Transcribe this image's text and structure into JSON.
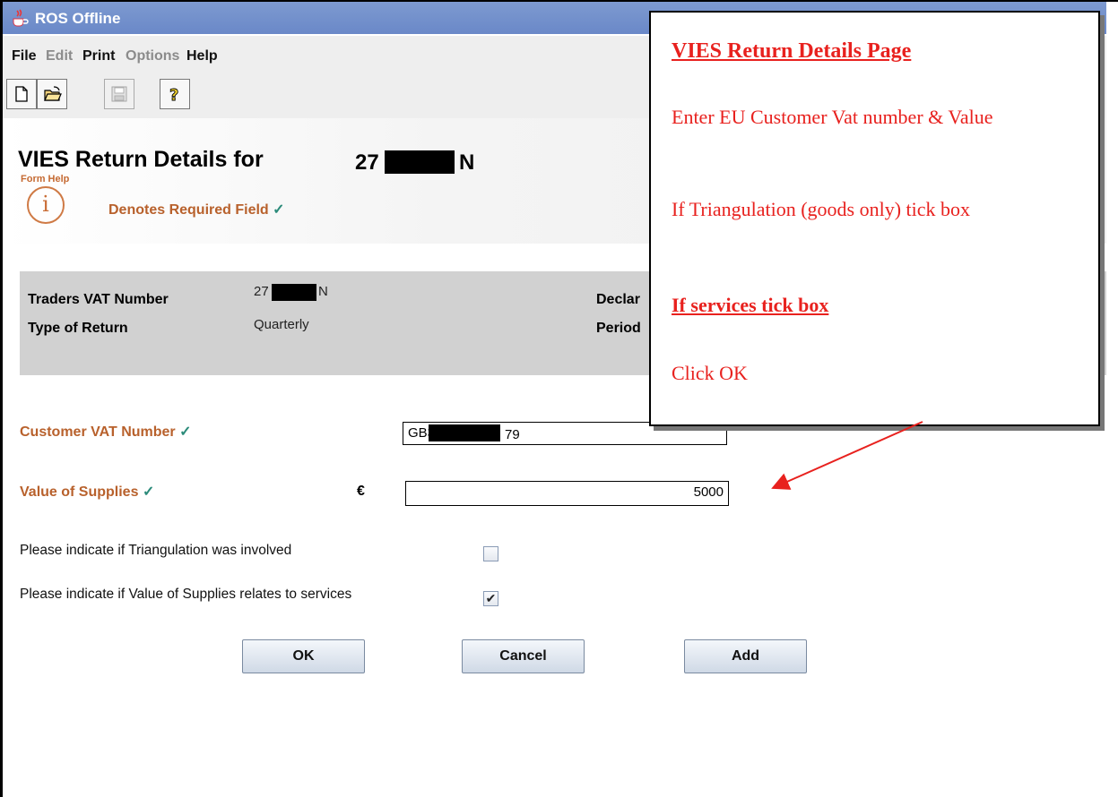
{
  "window": {
    "title": "ROS Offline"
  },
  "menu": [
    {
      "label": "File",
      "enabled": true
    },
    {
      "label": "Edit",
      "enabled": false
    },
    {
      "label": "Print",
      "enabled": true
    },
    {
      "label": "Options",
      "enabled": false
    },
    {
      "label": "Help",
      "enabled": true
    }
  ],
  "toolbar": {
    "icons": [
      "new-document-icon",
      "open-folder-icon",
      "save-icon",
      "help-icon"
    ]
  },
  "page": {
    "title": "VIES Return Details for",
    "trader_id_prefix": "27",
    "trader_id_suffix": "N",
    "form_help": "Form Help",
    "info_glyph": "i",
    "required_note": "Denotes Required Field",
    "check_glyph": "✓"
  },
  "summary": {
    "traders_vat_label": "Traders VAT Number",
    "traders_vat_prefix": "27",
    "traders_vat_suffix": "N",
    "type_label": "Type of Return",
    "type_value": "Quarterly",
    "declaration_label": "Declar",
    "period_label": "Period"
  },
  "form": {
    "customer_vat_label": "Customer VAT Number",
    "customer_vat_prefix": "GB3",
    "customer_vat_suffix": "79",
    "value_label": "Value of Supplies",
    "currency_symbol": "€",
    "value": "5000",
    "triangulation_label": "Please indicate if Triangulation was involved",
    "triangulation_checked": false,
    "services_label": "Please indicate if Value of Supplies relates to services",
    "services_checked": true,
    "services_check_glyph": "✔"
  },
  "buttons": {
    "ok": "OK",
    "cancel": "Cancel",
    "add": "Add"
  },
  "callout": {
    "heading": "VIES Return Details Page",
    "line1": "Enter EU Customer Vat number & Value",
    "line2": "If Triangulation (goods only) tick box",
    "line3": "If services tick box",
    "line4": "Click OK"
  },
  "colors": {
    "title_bar": "#7d9ad0",
    "label_orange": "#b8612c",
    "check_teal": "#2b8b7a",
    "callout_red": "#e8211e",
    "summary_bg": "#d1d1d1"
  }
}
